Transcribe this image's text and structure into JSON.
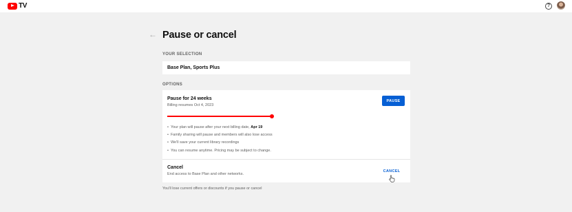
{
  "header": {
    "logo_text": "TV",
    "icons": [
      "youtube-logo-icon",
      "help-icon",
      "avatar"
    ],
    "help_glyph": "?"
  },
  "page": {
    "title": "Pause or cancel",
    "back_glyph": "←"
  },
  "selection": {
    "label": "YOUR SELECTION",
    "value": "Base Plan, Sports Plus"
  },
  "options": {
    "label": "OPTIONS",
    "pause": {
      "title": "Pause for 24 weeks",
      "subtitle": "Billing resumes Oct 4, 2023",
      "button_label": "PAUSE",
      "slider_fraction": 1.0,
      "bullets": [
        {
          "text": "Your plan will pause after your next billing date, ",
          "bold": "Apr 19"
        },
        {
          "text": "Family sharing will pause and members will also lose access",
          "bold": ""
        },
        {
          "text": "We'll save your current library recordings",
          "bold": ""
        },
        {
          "text": "You can resume anytime. Pricing may be subject to change.",
          "bold": ""
        }
      ]
    },
    "cancel": {
      "title": "Cancel",
      "subtitle": "End access to Base Plan and other networks.",
      "button_label": "CANCEL"
    }
  },
  "footer_note": "You'll lose current offers or discounts if you pause or cancel",
  "colors": {
    "accent_blue": "#065fd4",
    "brand_red": "#ff0000",
    "background": "#f1f1f1"
  }
}
